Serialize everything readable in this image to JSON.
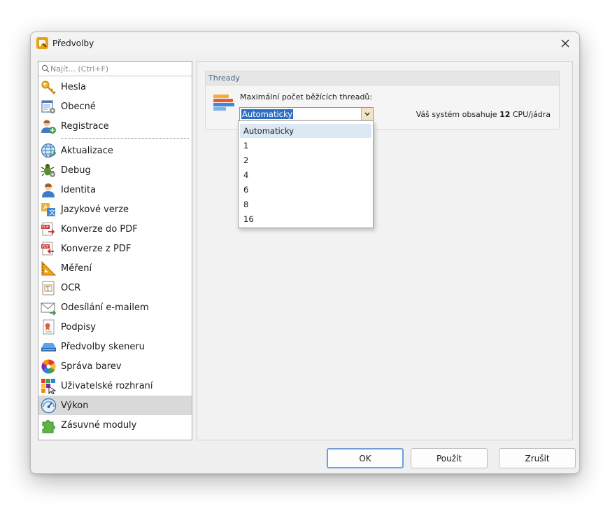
{
  "window": {
    "title": "Předvolby"
  },
  "search": {
    "placeholder": "Najít... (Ctrl+F)"
  },
  "sidebar": {
    "items": [
      {
        "label": "Hesla",
        "icon": "key-icon"
      },
      {
        "label": "Obecné",
        "icon": "general-settings-icon"
      },
      {
        "label": "Registrace",
        "icon": "user-add-icon"
      },
      {
        "label": "Aktualizace",
        "icon": "globe-update-icon"
      },
      {
        "label": "Debug",
        "icon": "bug-icon"
      },
      {
        "label": "Identita",
        "icon": "person-icon"
      },
      {
        "label": "Jazykové verze",
        "icon": "language-icon"
      },
      {
        "label": "Konverze do PDF",
        "icon": "pdf-convert-to-icon"
      },
      {
        "label": "Konverze z PDF",
        "icon": "pdf-convert-from-icon"
      },
      {
        "label": "Měření",
        "icon": "ruler-icon"
      },
      {
        "label": "OCR",
        "icon": "ocr-icon"
      },
      {
        "label": "Odesílání e-mailem",
        "icon": "email-icon"
      },
      {
        "label": "Podpisy",
        "icon": "signature-icon"
      },
      {
        "label": "Předvolby skeneru",
        "icon": "scanner-icon"
      },
      {
        "label": "Správa barev",
        "icon": "color-wheel-icon"
      },
      {
        "label": "Uživatelské rozhraní",
        "icon": "user-interface-icon"
      },
      {
        "label": "Výkon",
        "icon": "speedometer-icon",
        "selected": true
      },
      {
        "label": "Zásuvné moduly",
        "icon": "puzzle-icon"
      }
    ]
  },
  "group": {
    "title": "Thready",
    "field_label": "Maximální počet běžících threadů:",
    "selected_value": "Automaticky",
    "cpu_info_prefix": "Váš systém obsahuje ",
    "cpu_count": "12",
    "cpu_info_suffix": " CPU/jádra"
  },
  "dropdown": {
    "options": [
      "Automaticky",
      "1",
      "2",
      "4",
      "6",
      "8",
      "16"
    ]
  },
  "buttons": {
    "ok": "OK",
    "apply": "Použít",
    "cancel": "Zrušit"
  },
  "colors": {
    "accent": "#2e6fc2",
    "selected_row": "#d9d9d9",
    "dropdown_highlight": "#dde8f5"
  }
}
